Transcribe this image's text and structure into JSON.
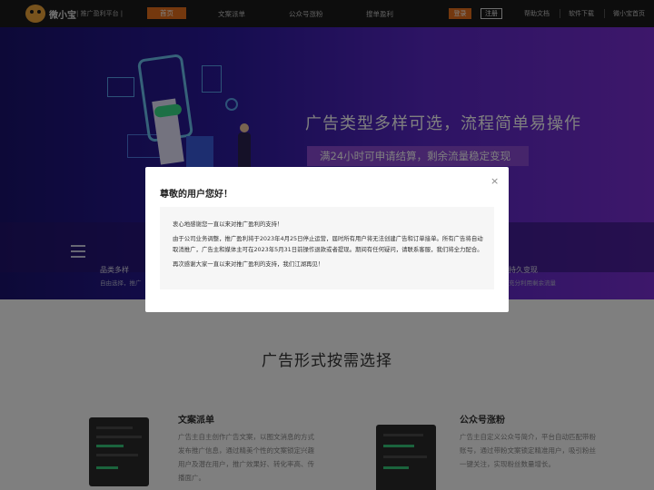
{
  "nav": {
    "brand": "微小宝",
    "slogan": "| 推广盈利平台 |",
    "items": [
      {
        "label": "首页",
        "active": true
      },
      {
        "label": "文案派单"
      },
      {
        "label": "公众号涨粉"
      },
      {
        "label": "搜单盈利"
      }
    ],
    "login_label": "登录",
    "register_label": "注册",
    "right_links": [
      "帮助文档",
      "软件下载",
      "微小宝首页"
    ]
  },
  "banner": {
    "headline": "广告类型多样可选，流程简单易操作",
    "tagline": "满24小时可申请结算，剩余流量稳定变现",
    "feature_left": {
      "title": "品类多样",
      "desc": "自由选择，推广"
    },
    "feature_right": {
      "title": "持久变现",
      "desc": "充分利用剩余流量"
    }
  },
  "main": {
    "section_title": "广告形式按需选择",
    "cards": [
      {
        "title": "文案派单",
        "desc": "广告主自主创作广告文案，以图文消息的方式发布推广信息，通过精美个性的文案锁定兴趣用户及潜在用户，推广效果好、转化率高、传播面广。"
      },
      {
        "title": "公众号涨粉",
        "desc": "广告主自定义公众号简介，平台自动匹配带粉账号，通过带粉文案锁定精准用户，吸引粉丝一键关注，实现粉丝数量增长。"
      }
    ]
  },
  "modal": {
    "title": "尊敬的用户您好！",
    "close_label": "×",
    "paragraphs": [
      "衷心地感谢您一直以来对推广盈利的支持！",
      "由于公司业务调整，推广盈利将于2023年4月25日停止运营，届时所有用户将无法创建广告和订单接单。所有广告将自动取消推广，广告主和媒体主可在2023年5月31日前操作退款或者提现。期间有任何疑问，请联系客服，我们将全力配合。",
      "再次感谢大家一直以来对推广盈利的支持，我们江湖再见！"
    ]
  },
  "colors": {
    "accent": "#e8711c",
    "nav_bg": "#1b1b1b",
    "banner_start": "#1a1370",
    "banner_end": "#7b2fd6",
    "tagline_bg": "#8c4ad6"
  }
}
